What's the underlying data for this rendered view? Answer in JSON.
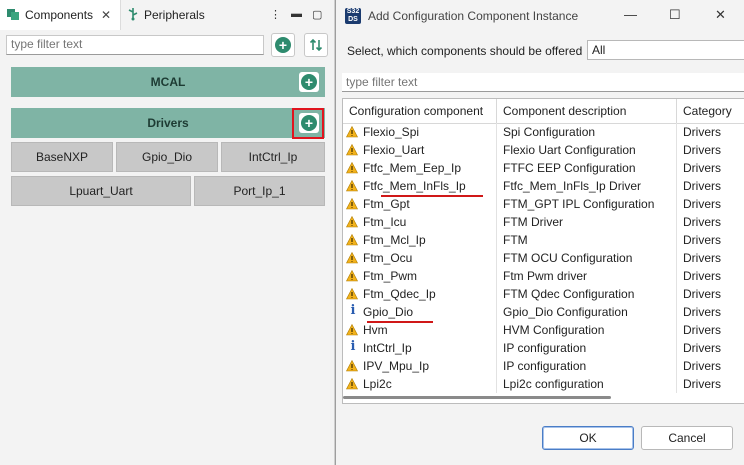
{
  "left_panel": {
    "tabs": [
      {
        "label": "Components",
        "icon": "components-icon"
      },
      {
        "label": "Peripherals",
        "icon": "usb-icon"
      }
    ],
    "filter_placeholder": "type filter text",
    "groups": [
      {
        "label": "MCAL"
      },
      {
        "label": "Drivers"
      }
    ],
    "components": [
      "BaseNXP",
      "Gpio_Dio",
      "IntCtrl_Ip",
      "Lpuart_Uart",
      "Port_Ip_1"
    ]
  },
  "dialog": {
    "title": "Add Configuration Component Instance",
    "offer_label": "Select, which components should be offered",
    "offer_value": "All",
    "filter_placeholder": "type filter text",
    "columns": [
      "Configuration component",
      "Component description",
      "Category"
    ],
    "rows": [
      {
        "name": "Flexio_Spi",
        "desc": "Spi Configuration",
        "cat": "Drivers",
        "icon": "warning"
      },
      {
        "name": "Flexio_Uart",
        "desc": "Flexio Uart Configuration",
        "cat": "Drivers",
        "icon": "warning"
      },
      {
        "name": "Ftfc_Mem_Eep_Ip",
        "desc": "FTFC EEP Configuration",
        "cat": "Drivers",
        "icon": "warning"
      },
      {
        "name": "Ftfc_Mem_InFls_Ip",
        "desc": "Ftfc_Mem_InFls_Ip Driver",
        "cat": "Drivers",
        "icon": "warning"
      },
      {
        "name": "Ftm_Gpt",
        "desc": "FTM_GPT IPL Configuration",
        "cat": "Drivers",
        "icon": "warning"
      },
      {
        "name": "Ftm_Icu",
        "desc": "FTM Driver",
        "cat": "Drivers",
        "icon": "warning"
      },
      {
        "name": "Ftm_Mcl_Ip",
        "desc": "FTM",
        "cat": "Drivers",
        "icon": "warning"
      },
      {
        "name": "Ftm_Ocu",
        "desc": "FTM OCU Configuration",
        "cat": "Drivers",
        "icon": "warning"
      },
      {
        "name": "Ftm_Pwm",
        "desc": "Ftm Pwm driver",
        "cat": "Drivers",
        "icon": "warning"
      },
      {
        "name": "Ftm_Qdec_Ip",
        "desc": "FTM Qdec Configuration",
        "cat": "Drivers",
        "icon": "warning"
      },
      {
        "name": "Gpio_Dio",
        "desc": "Gpio_Dio Configuration",
        "cat": "Drivers",
        "icon": "info"
      },
      {
        "name": "Hvm",
        "desc": "HVM Configuration",
        "cat": "Drivers",
        "icon": "warning"
      },
      {
        "name": "IntCtrl_Ip",
        "desc": "IP configuration",
        "cat": "Drivers",
        "icon": "info"
      },
      {
        "name": "IPV_Mpu_Ip",
        "desc": "IP configuration",
        "cat": "Drivers",
        "icon": "warning"
      },
      {
        "name": "Lpi2c",
        "desc": "Lpi2c configuration",
        "cat": "Drivers",
        "icon": "warning"
      }
    ],
    "ok_label": "OK",
    "cancel_label": "Cancel"
  },
  "colors": {
    "group_bar": "#7fb4a5",
    "plus_button": "#2e8b6e",
    "highlight": "#e0141e",
    "warning": "#f2b21c",
    "info": "#2a5db0"
  }
}
